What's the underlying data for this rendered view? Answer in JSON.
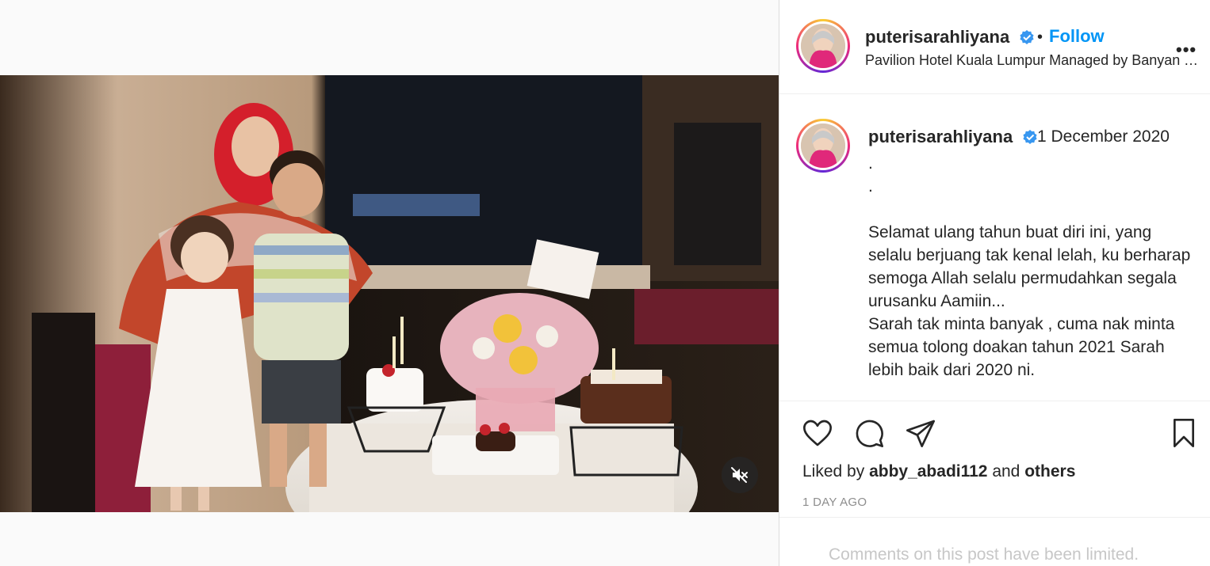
{
  "post": {
    "username": "puterisarahliyana",
    "follow_label": "Follow",
    "dot": "•",
    "location": "Pavilion Hotel Kuala Lumpur Managed by Banyan Tree",
    "more_label": "•••"
  },
  "caption": {
    "username": "puterisarahliyana",
    "date": "1 December 2020",
    "text": ".\n.\n\nSelamat ulang tahun buat diri ini, yang selalu berjuang tak kenal lelah, ku berharap semoga Allah selalu permudahkan segala urusanku Aamiin...\nSarah tak minta banyak , cuma nak minta semua tolong doakan tahun 2021 Sarah lebih baik dari 2020 ni."
  },
  "likes": {
    "prefix": "Liked by ",
    "user": "abby_abadi112",
    "middle": " and ",
    "others": "others"
  },
  "time_ago": "1 DAY AGO",
  "comments_notice": "Comments on this post have been limited.",
  "icons": {
    "verified": "verified-badge-icon",
    "like": "heart-icon",
    "comment": "comment-bubble-icon",
    "share": "paper-plane-icon",
    "save": "bookmark-icon",
    "mute": "speaker-muted-icon"
  },
  "colors": {
    "accent": "#0095f6",
    "text": "#262626",
    "muted": "#8e8e8e"
  }
}
